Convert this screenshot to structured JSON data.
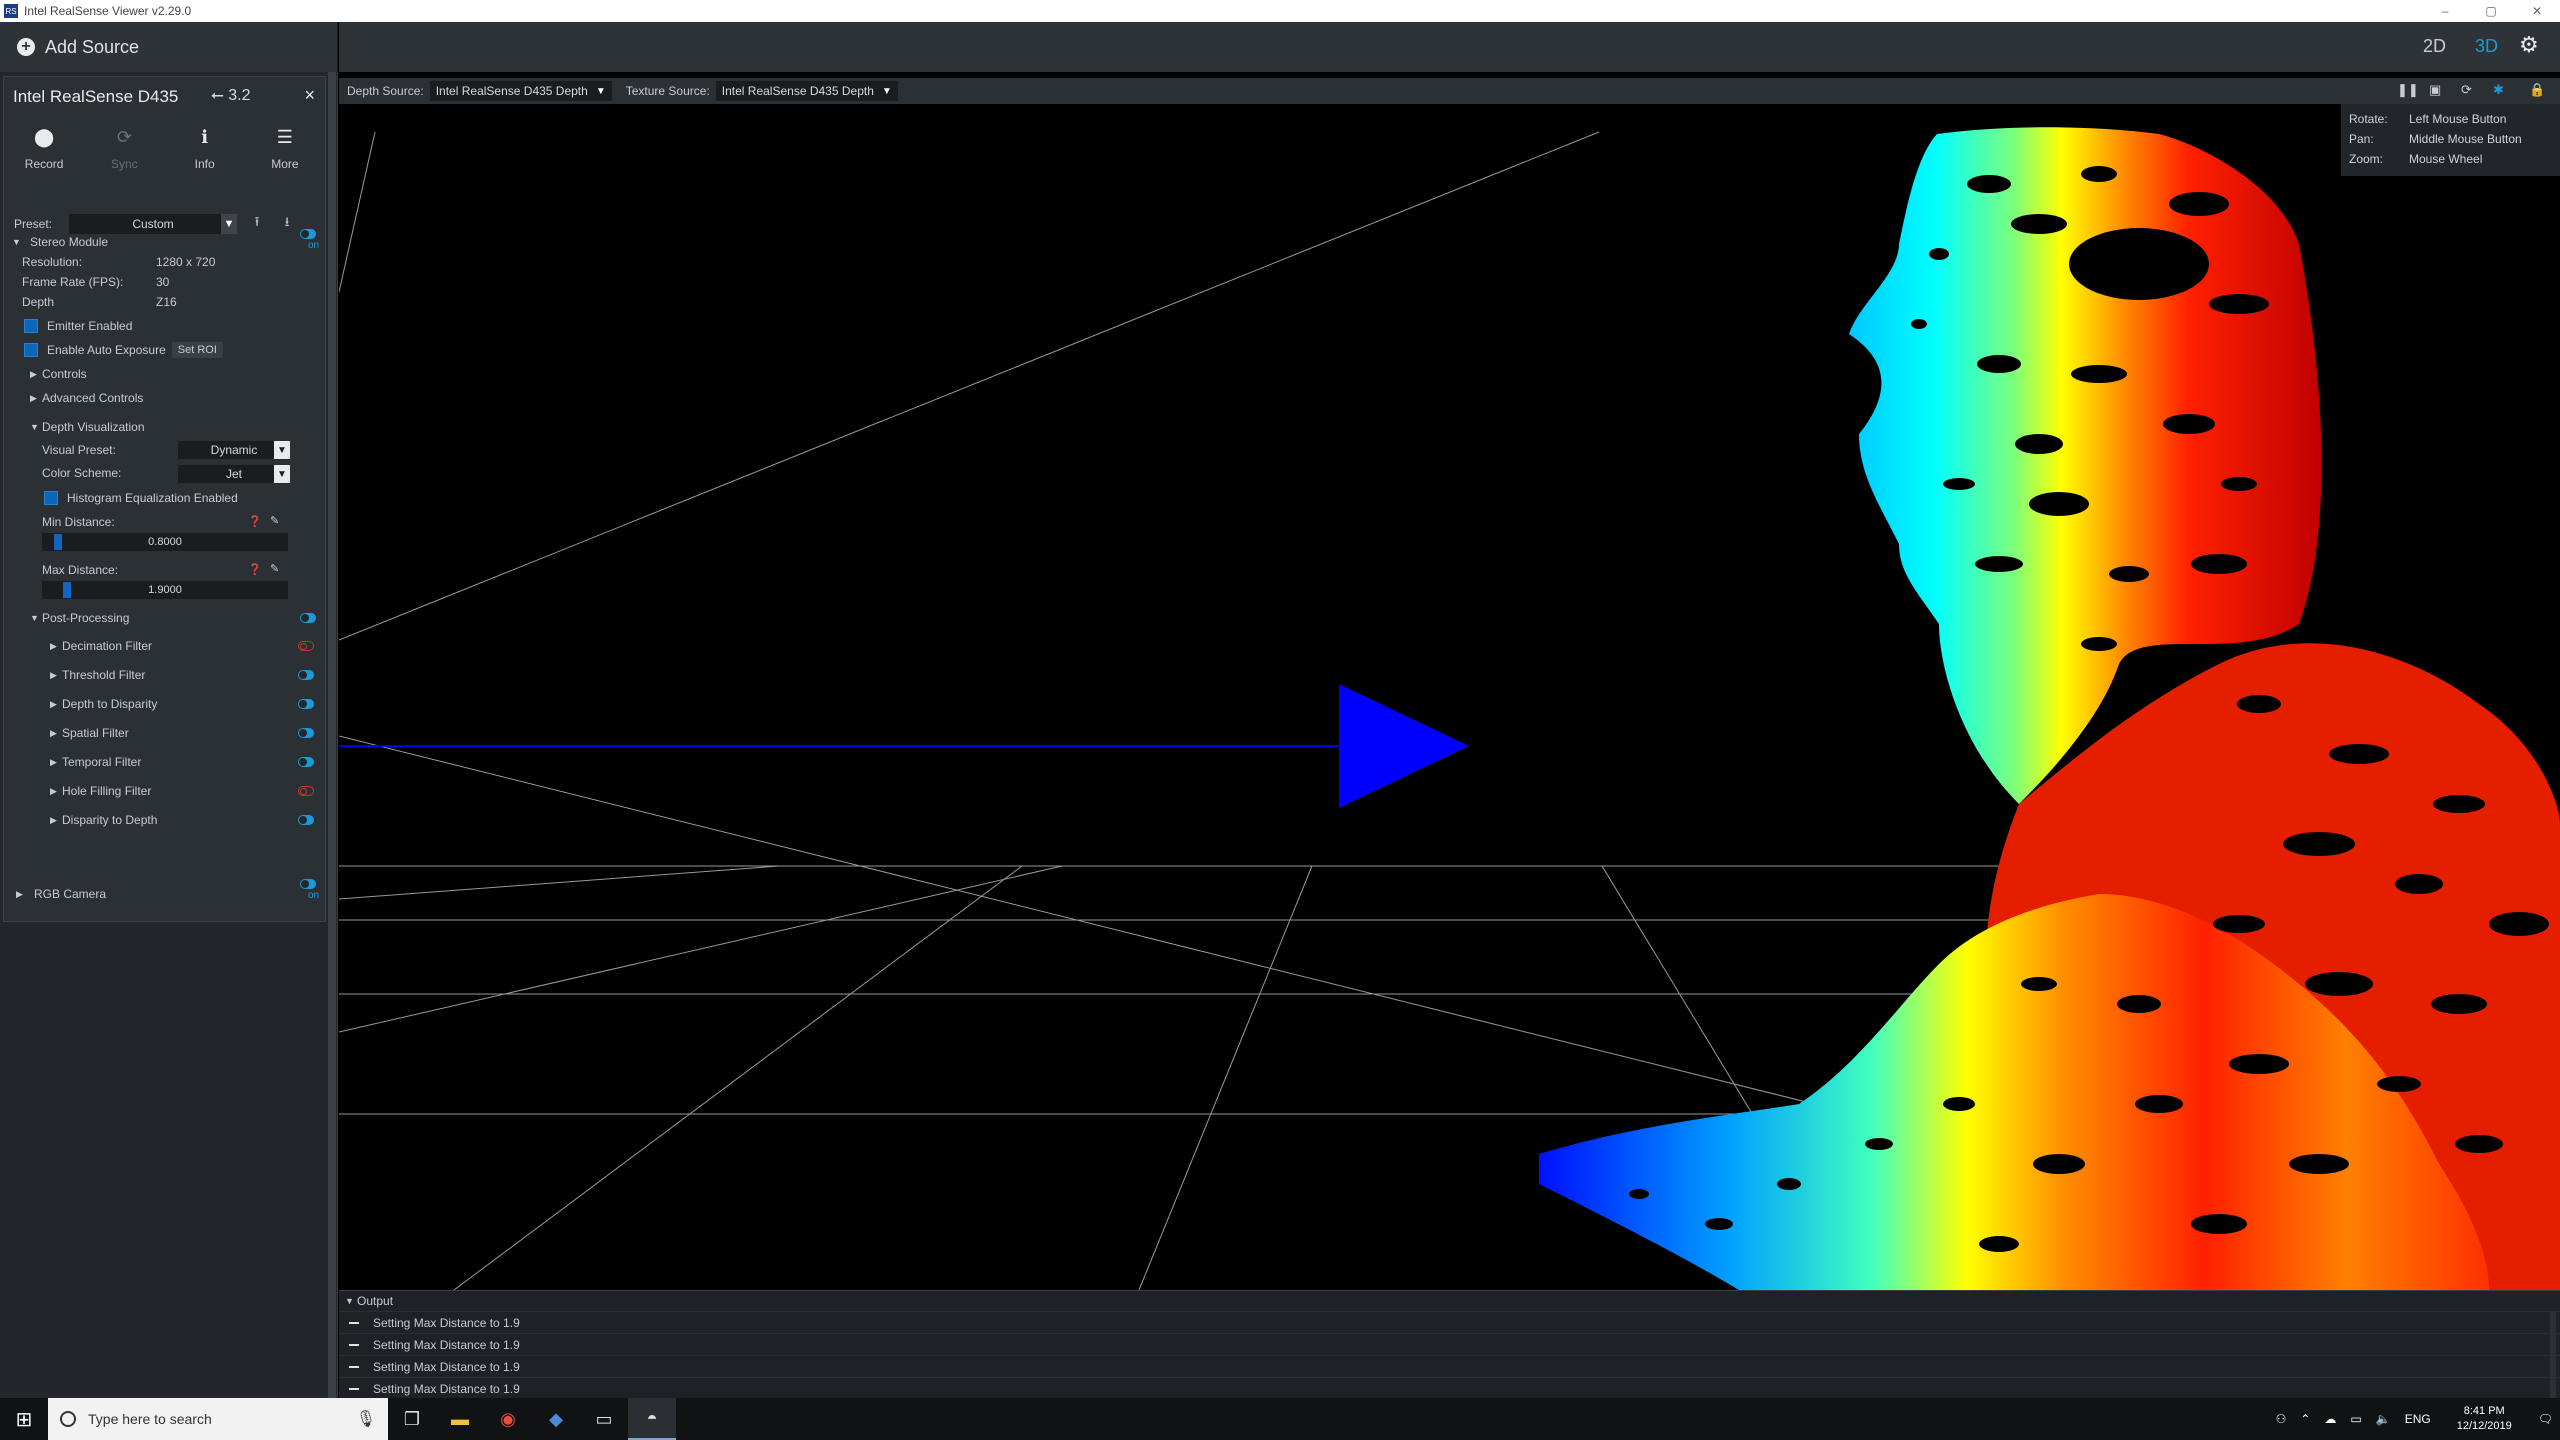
{
  "window": {
    "title": "Intel RealSense Viewer v2.29.0",
    "controls": [
      "–",
      "▢",
      "✕"
    ]
  },
  "left": {
    "add_source": "Add Source",
    "device": {
      "name": "Intel RealSense D435",
      "usb": "3.2",
      "close": "×",
      "buttons": [
        {
          "label": "Record",
          "icon": "record-icon",
          "glyph": "⬤"
        },
        {
          "label": "Sync",
          "icon": "sync-icon",
          "glyph": "⟳"
        },
        {
          "label": "Info",
          "icon": "info-icon",
          "glyph": "ℹ"
        },
        {
          "label": "More",
          "icon": "menu-icon",
          "glyph": "☰"
        }
      ],
      "preset_label": "Preset:",
      "preset_value": "Custom",
      "stereo_module": "Stereo Module",
      "on": "on",
      "resolution_label": "Resolution:",
      "resolution_value": "1280 x 720",
      "fps_label": "Frame Rate (FPS):",
      "fps_value": "30",
      "depth_label": "Depth",
      "depth_value": "Z16",
      "emitter": "Emitter Enabled",
      "auto_exposure": "Enable Auto Exposure",
      "set_roi": "Set ROI",
      "controls": "Controls",
      "advanced_controls": "Advanced Controls",
      "depth_viz": "Depth Visualization",
      "visual_preset_label": "Visual Preset:",
      "visual_preset_value": "Dynamic",
      "color_scheme_label": "Color Scheme:",
      "color_scheme_value": "Jet",
      "histogram": "Histogram Equalization Enabled",
      "min_dist_label": "Min Distance:",
      "min_dist_value": "0.8000",
      "min_dist_level": 0.05,
      "max_dist_label": "Max Distance:",
      "max_dist_value": "1.9000",
      "max_dist_level": 0.09,
      "post_processing": "Post-Processing",
      "filters": [
        {
          "label": "Decimation Filter",
          "enabled": false
        },
        {
          "label": "Threshold Filter",
          "enabled": true
        },
        {
          "label": "Depth to Disparity",
          "enabled": true
        },
        {
          "label": "Spatial Filter",
          "enabled": true
        },
        {
          "label": "Temporal Filter",
          "enabled": true
        },
        {
          "label": "Hole Filling Filter",
          "enabled": false
        },
        {
          "label": "Disparity to Depth",
          "enabled": true
        }
      ],
      "rgb_camera": "RGB Camera"
    }
  },
  "topbar": {
    "view_2d": "2D",
    "view_3d": "3D"
  },
  "viewport_header": {
    "depth_source_label": "Depth Source:",
    "depth_source_value": "Intel RealSense D435 Depth",
    "texture_source_label": "Texture Source:",
    "texture_source_value": "Intel RealSense D435 Depth"
  },
  "help": {
    "rotate_label": "Rotate:",
    "rotate_value": "Left Mouse Button",
    "pan_label": "Pan:",
    "pan_value": "Middle Mouse Button",
    "zoom_label": "Zoom:",
    "zoom_value": "Mouse Wheel"
  },
  "output": {
    "title": "Output",
    "lines": [
      "Setting Max Distance to 1.9",
      "Setting Max Distance to 1.9",
      "Setting Max Distance to 1.9",
      "Setting Max Distance to 1.9"
    ]
  },
  "taskbar": {
    "search_placeholder": "Type here to search",
    "lang": "ENG",
    "time": "8:41 PM",
    "date": "12/12/2019"
  },
  "colors": {
    "accent": "#1a9bd7",
    "panel": "#23272b",
    "toolbar": "#2e3338",
    "off": "#c0392b"
  }
}
